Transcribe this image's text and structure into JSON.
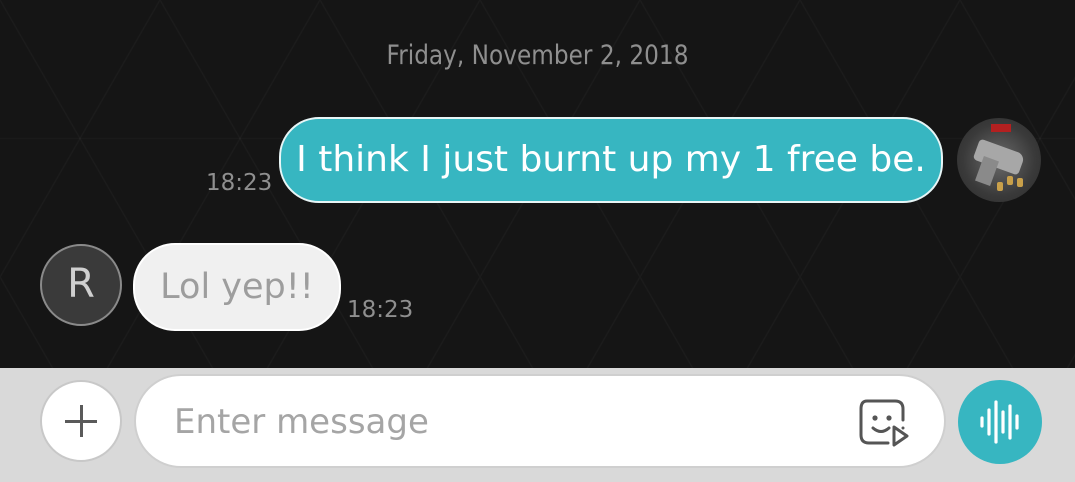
{
  "conversation": {
    "date_divider": "Friday, November 2, 2018",
    "messages": [
      {
        "direction": "outgoing",
        "text": "I think I just burnt up my 1 free be.",
        "time": "18:23"
      },
      {
        "direction": "incoming",
        "sender_initial": "R",
        "text": "Lol yep!!",
        "time": "18:23"
      }
    ]
  },
  "composer": {
    "placeholder": "Enter message",
    "value": "",
    "icons": {
      "add": "plus-icon",
      "sticker": "sticker-icon",
      "voice": "voice-wave-icon"
    }
  },
  "colors": {
    "accent": "#37b6c1",
    "background": "#151515",
    "incoming_bubble": "#f0f0f0",
    "timestamp": "#8f8f8f",
    "input_bar": "#d9d9d9"
  }
}
